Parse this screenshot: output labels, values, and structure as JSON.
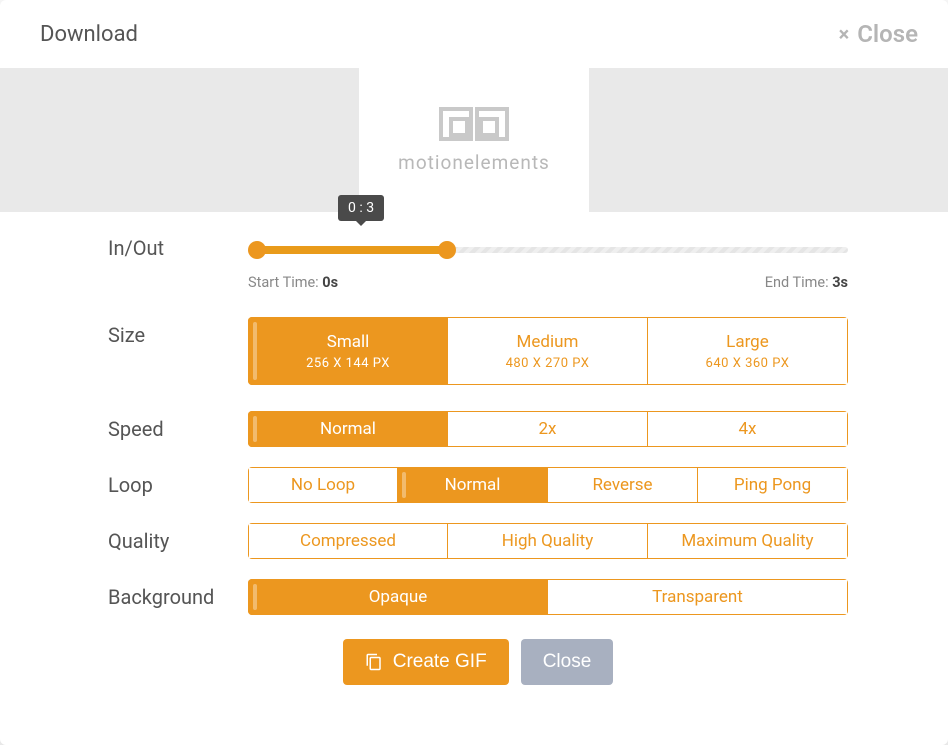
{
  "header": {
    "title": "Download",
    "close": "Close"
  },
  "preview": {
    "brand": "motionelements"
  },
  "inout": {
    "label": "In/Out",
    "tooltip": "0 : 3",
    "start_label": "Start Time:",
    "start_value": "0s",
    "end_label": "End Time:",
    "end_value": "3s"
  },
  "size": {
    "label": "Size",
    "options": [
      {
        "name": "Small",
        "dim": "256 X 144 PX",
        "active": true
      },
      {
        "name": "Medium",
        "dim": "480 X 270 PX",
        "active": false
      },
      {
        "name": "Large",
        "dim": "640 X 360 PX",
        "active": false
      }
    ]
  },
  "speed": {
    "label": "Speed",
    "options": [
      "Normal",
      "2x",
      "4x"
    ],
    "active": 0
  },
  "loop": {
    "label": "Loop",
    "options": [
      "No Loop",
      "Normal",
      "Reverse",
      "Ping Pong"
    ],
    "active": 1
  },
  "quality": {
    "label": "Quality",
    "options": [
      "Compressed",
      "High Quality",
      "Maximum Quality"
    ],
    "active": -1
  },
  "background": {
    "label": "Background",
    "options": [
      "Opaque",
      "Transparent"
    ],
    "active": 0
  },
  "footer": {
    "create": "Create GIF",
    "close": "Close"
  },
  "colors": {
    "accent": "#ec971f"
  }
}
